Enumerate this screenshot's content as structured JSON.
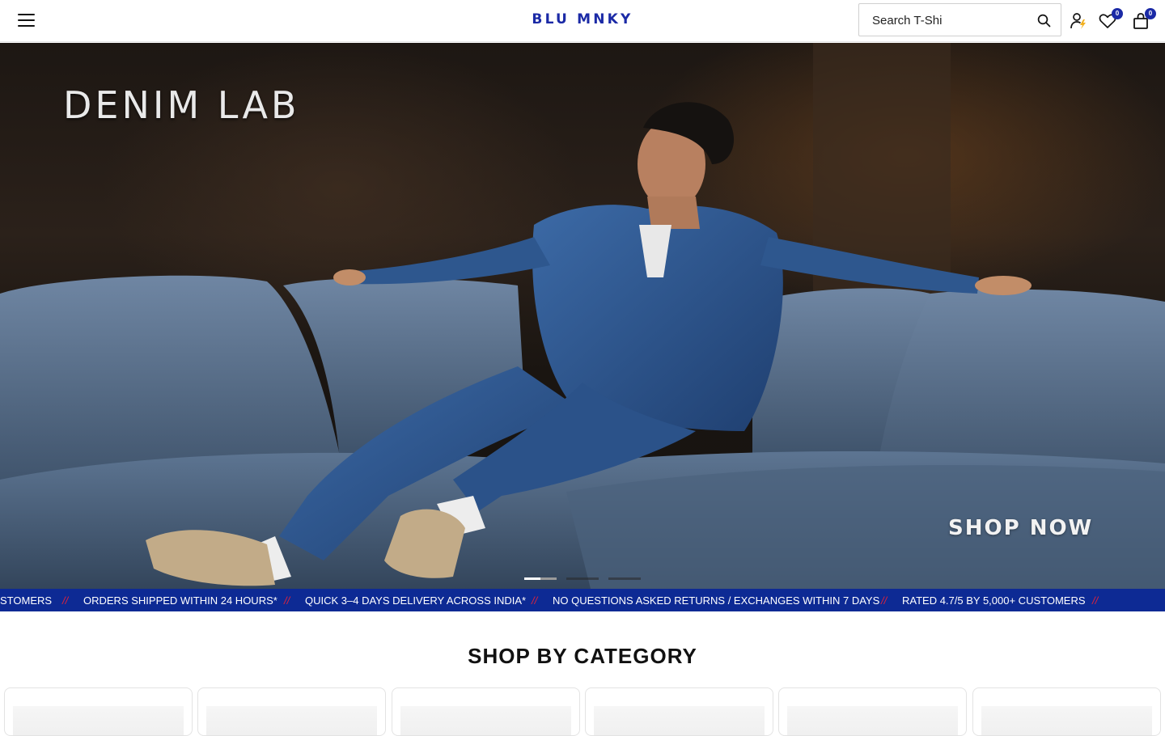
{
  "header": {
    "logo": "BLU MNKY",
    "search_placeholder": "Search T-Shi",
    "icons": [
      "menu-icon",
      "search-icon",
      "account-icon",
      "wishlist-icon",
      "cart-icon"
    ],
    "wishlist_count": "0",
    "cart_count": "0",
    "brand_color": "#1b2aa6"
  },
  "hero": {
    "title": "DENIM LAB",
    "cta": "SHOP NOW",
    "slides": 3,
    "active_slide": 1
  },
  "ticker": {
    "background": "#0d2a94",
    "separator": "//",
    "items": [
      "STOMERS",
      "ORDERS SHIPPED WITHIN 24 HOURS*",
      "QUICK 3–4 DAYS DELIVERY ACROSS INDIA*",
      "NO QUESTIONS ASKED RETURNS / EXCHANGES WITHIN 7 DAYS",
      "RATED 4.7/5 BY 5,000+ CUSTOMERS"
    ]
  },
  "categories": {
    "title": "SHOP BY CATEGORY",
    "cards": 6
  }
}
